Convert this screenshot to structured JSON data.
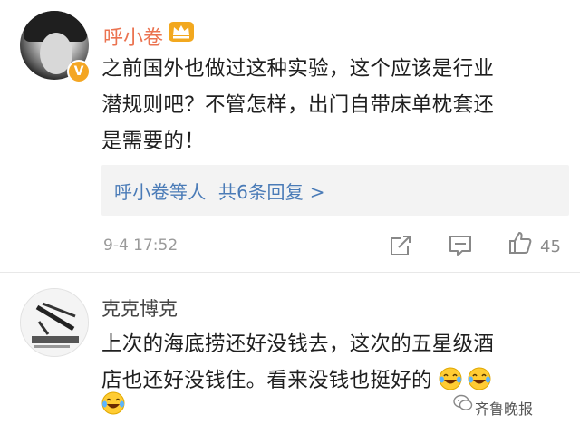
{
  "comment1": {
    "username": "呼小卷",
    "verified_badge": "V",
    "text_lines": [
      "之前国外也做过这种实验，这个应该是行业",
      "潜规则吧？不管怎样，出门自带床单枕套还",
      "是需要的！"
    ],
    "replies_link": "呼小卷等人  共6条回复 >",
    "timestamp": "9-4 17:52",
    "like_count": "45",
    "icons": [
      "share-icon",
      "comment-icon",
      "thumbs-up-icon",
      "crown-icon"
    ]
  },
  "comment2": {
    "username": "克克博克",
    "text_lines": [
      "上次的海底捞还好没钱去，这次的五星级酒",
      "店也还好没钱住。看来没钱也挺好的"
    ],
    "emoji": "laughing-crying-emoji"
  },
  "watermark": {
    "text": "齐鲁晚报"
  },
  "colors": {
    "username_accent": "#eb7350",
    "link": "#4a7bb7",
    "meta_gray": "#9a9a9a"
  }
}
